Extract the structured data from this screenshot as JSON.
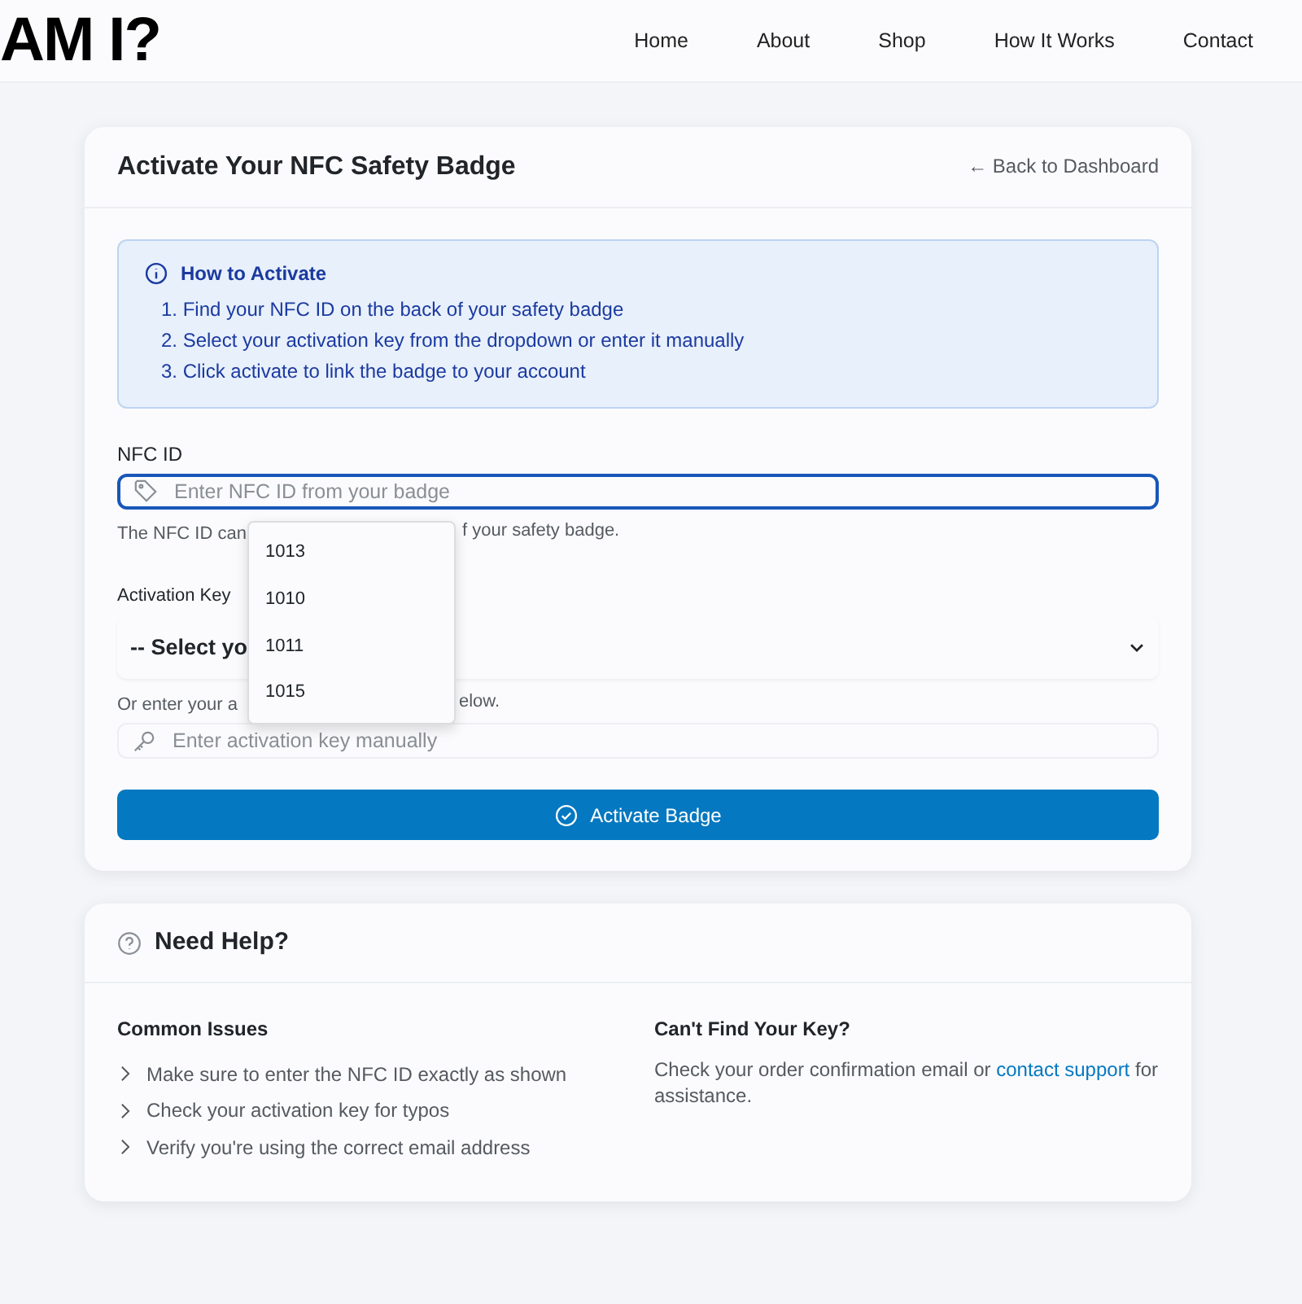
{
  "navbar": {
    "logo": "AM I?",
    "links": [
      {
        "label": "Home"
      },
      {
        "label": "About"
      },
      {
        "label": "Shop"
      },
      {
        "label": "How It Works"
      },
      {
        "label": "Contact"
      }
    ]
  },
  "activate_card": {
    "title": "Activate Your NFC Safety Badge",
    "back_link": "← Back to Dashboard",
    "info": {
      "title": "How to Activate",
      "steps": [
        "1. Find your NFC ID on the back of your safety badge",
        "2. Select your activation key from the dropdown or enter it manually",
        "3. Click activate to link the badge to your account"
      ]
    },
    "nfc_id": {
      "label": "NFC ID",
      "placeholder": "Enter NFC ID from your badge",
      "hint_before": "The NFC ID can",
      "hint_after": "f your safety badge."
    },
    "activation_key": {
      "label": "Activation Key",
      "select_text": "-- Select yo",
      "or_text_before": "Or enter your a",
      "or_text_after": "elow.",
      "placeholder": "Enter activation key manually"
    },
    "button": "Activate Badge",
    "suggestions": [
      "1013",
      "1010",
      "1011",
      "1015"
    ]
  },
  "help_card": {
    "title": "Need Help?",
    "issues_title": "Common Issues",
    "issues": [
      "Make sure to enter the NFC ID exactly as shown",
      "Check your activation key for typos",
      "Verify you're using the correct email address"
    ],
    "key_title": "Can't Find Your Key?",
    "key_text_before": "Check your order confirmation email or ",
    "key_link": "contact support",
    "key_text_after": "for assistance."
  }
}
